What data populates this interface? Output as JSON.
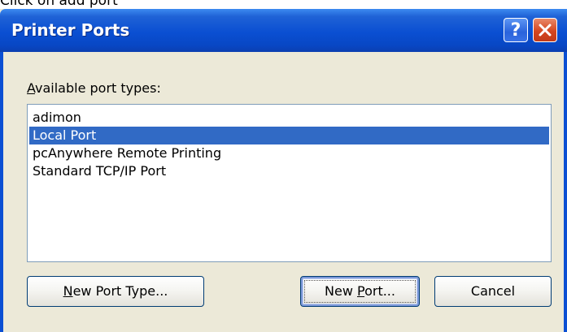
{
  "caption": "Click on add port",
  "window": {
    "title": "Printer Ports",
    "help_label": "?"
  },
  "ports": {
    "label_prefix": "A",
    "label_rest": "vailable port types:",
    "items": [
      {
        "label": "adimon"
      },
      {
        "label": "Local Port"
      },
      {
        "label": "pcAnywhere Remote Printing"
      },
      {
        "label": "Standard TCP/IP Port"
      }
    ],
    "selected": "Local Port"
  },
  "buttons": {
    "new_port_type_prefix": "N",
    "new_port_type_rest": "ew Port Type...",
    "new_port_prefix": "New ",
    "new_port_accel": "P",
    "new_port_rest": "ort...",
    "cancel": "Cancel"
  },
  "colors": {
    "selection": "#316ac5",
    "titlebar": "#0a4fd2",
    "dialog_bg": "#ece9d8"
  }
}
